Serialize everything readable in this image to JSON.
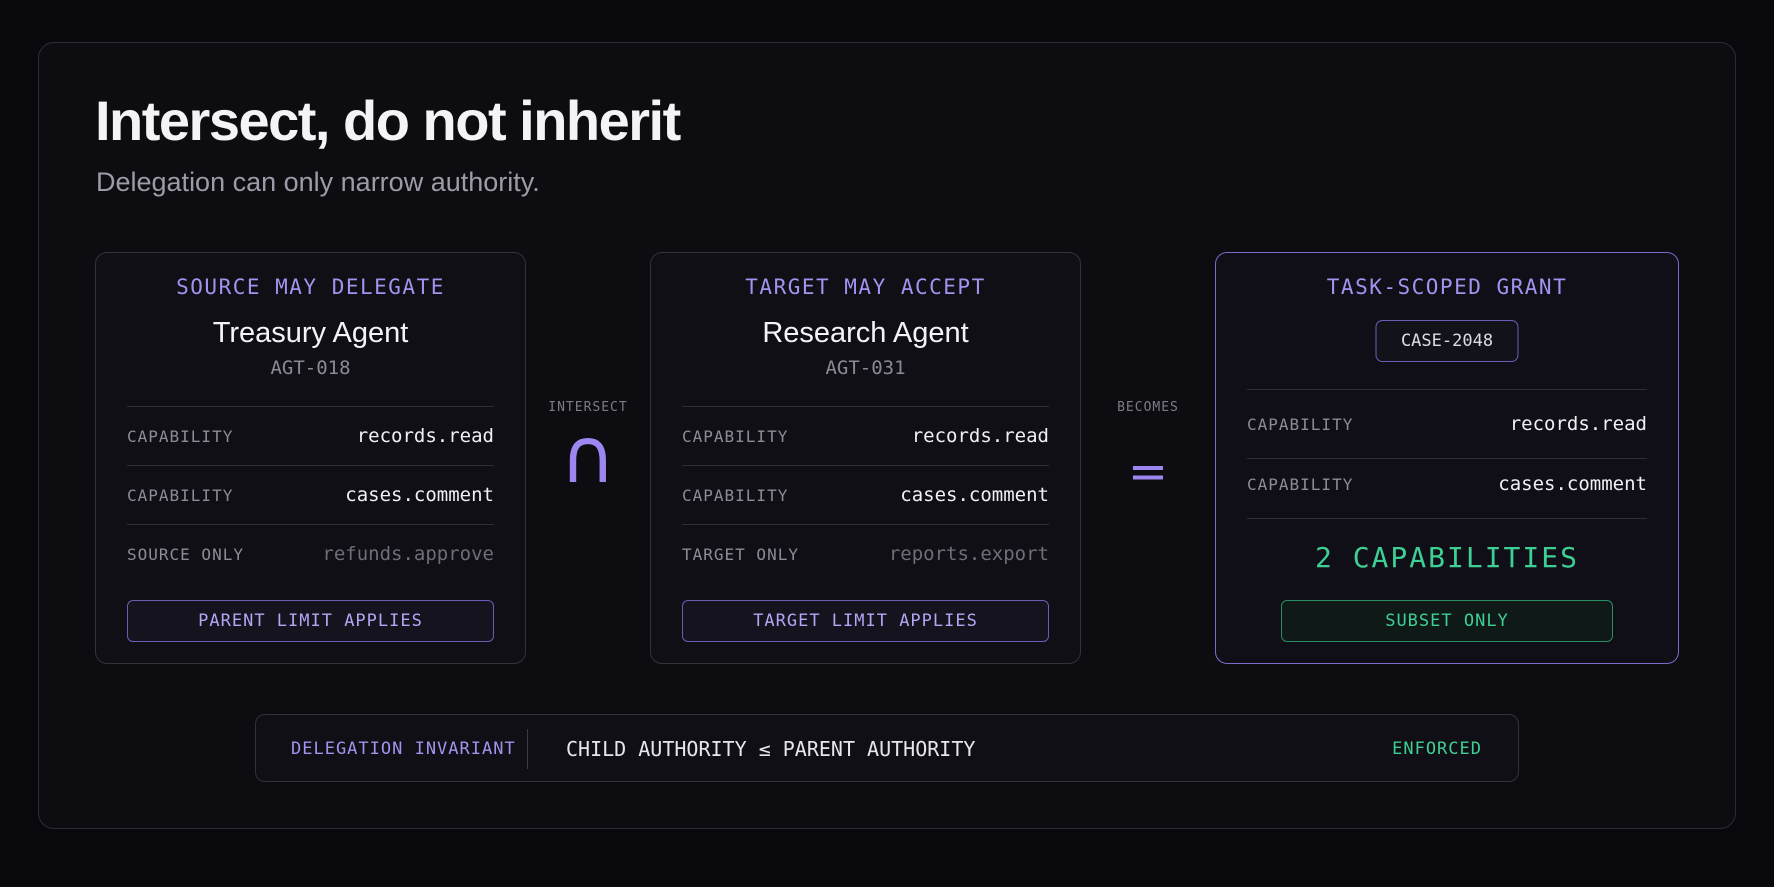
{
  "header": {
    "title": "Intersect, do not inherit",
    "subtitle": "Delegation can only narrow authority."
  },
  "source": {
    "label": "SOURCE MAY DELEGATE",
    "agent_name": "Treasury Agent",
    "agent_id": "AGT-018",
    "rows": [
      {
        "key": "CAPABILITY",
        "value": "records.read"
      },
      {
        "key": "CAPABILITY",
        "value": "cases.comment"
      },
      {
        "key": "SOURCE ONLY",
        "value": "refunds.approve"
      }
    ],
    "limit": "PARENT LIMIT APPLIES"
  },
  "operator_intersect": {
    "label": "INTERSECT",
    "symbol": "∩"
  },
  "target": {
    "label": "TARGET MAY ACCEPT",
    "agent_name": "Research Agent",
    "agent_id": "AGT-031",
    "rows": [
      {
        "key": "CAPABILITY",
        "value": "records.read"
      },
      {
        "key": "CAPABILITY",
        "value": "cases.comment"
      },
      {
        "key": "TARGET ONLY",
        "value": "reports.export"
      }
    ],
    "limit": "TARGET LIMIT APPLIES"
  },
  "operator_becomes": {
    "label": "BECOMES",
    "symbol": "="
  },
  "grant": {
    "label": "TASK-SCOPED GRANT",
    "case_id": "CASE-2048",
    "rows": [
      {
        "key": "CAPABILITY",
        "value": "records.read"
      },
      {
        "key": "CAPABILITY",
        "value": "cases.comment"
      }
    ],
    "count": "2 CAPABILITIES",
    "status": "SUBSET ONLY"
  },
  "invariant": {
    "label": "DELEGATION INVARIANT",
    "text": "CHILD AUTHORITY ≤ PARENT AUTHORITY",
    "status": "ENFORCED"
  },
  "colors": {
    "accent_purple": "#a392ee",
    "accent_green": "#3ecf94",
    "background": "#09090d"
  }
}
